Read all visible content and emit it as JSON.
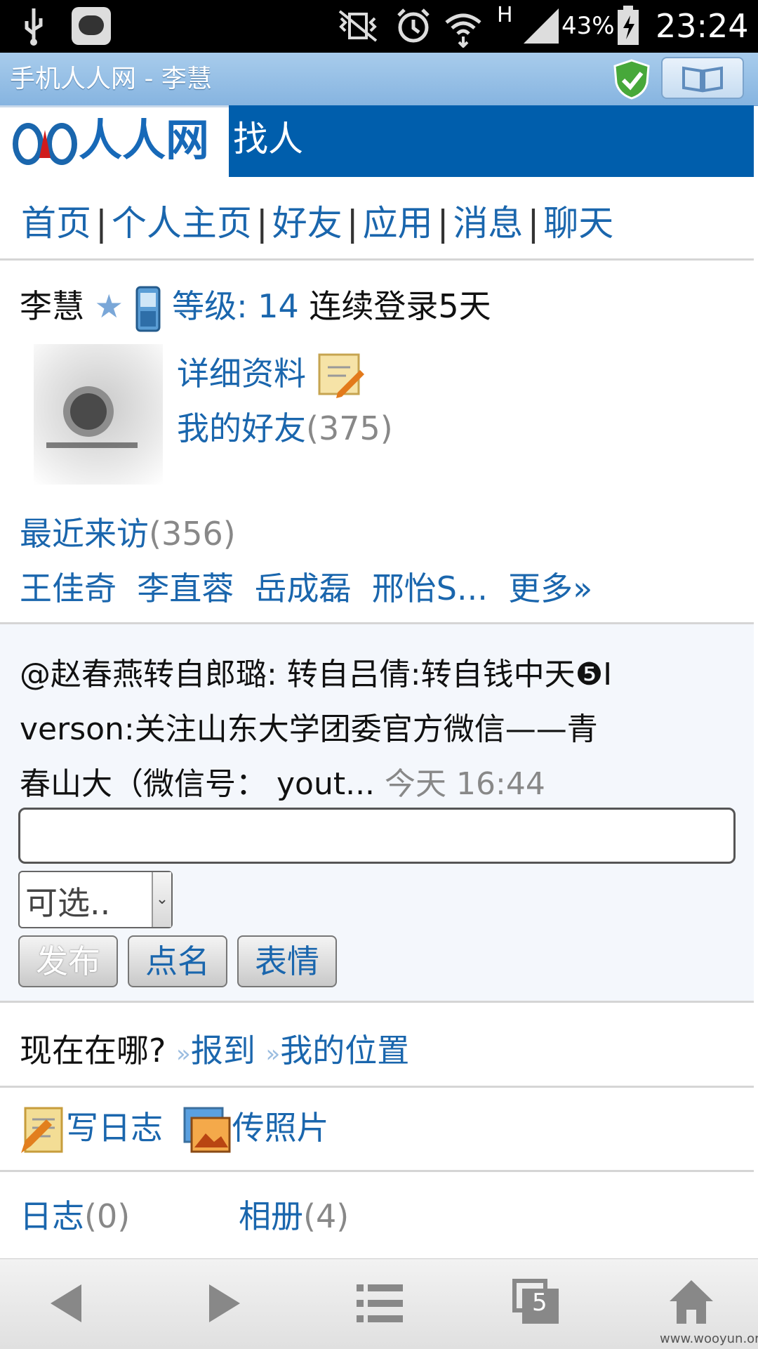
{
  "status_bar": {
    "battery": "43%",
    "network": "H",
    "time": "23:24"
  },
  "browser": {
    "title": "手机人人网 - 李慧"
  },
  "header": {
    "logo": "人人网",
    "page_title": "找人"
  },
  "nav": [
    "首页",
    "个人主页",
    "好友",
    "应用",
    "消息",
    "聊天"
  ],
  "profile": {
    "name": "李慧",
    "level": "等级: 14",
    "login_streak": "连续登录5天",
    "details_link": "详细资料",
    "friends_label": "我的好友",
    "friends_count": "(375)",
    "visitors_label": "最近来访",
    "visitors_count": "(356)",
    "recent_visitors": [
      "王佳奇",
      "李直蓉",
      "岳成磊",
      "邢怡S..."
    ],
    "more_link": "更多»"
  },
  "status_post": {
    "text_line1": "@赵春燕转自郎璐: 转自吕倩:转自钱中天❺I",
    "text_line2": "verson:关注山东大学团委官方微信——青",
    "text_line3": "春山大（微信号： yout...",
    "time": "今天 16:44",
    "input_placeholder": "",
    "select_value": "可选..",
    "buttons": [
      "发布",
      "点名",
      "表情"
    ]
  },
  "location": {
    "question": "现在在哪?",
    "checkin": "报到",
    "my_location": "我的位置"
  },
  "actions": {
    "write_blog": "写日志",
    "upload_photo": "传照片"
  },
  "stats": {
    "blog_label": "日志",
    "blog_count": "(0)",
    "album_label": "相册",
    "album_count": "(4)"
  },
  "bottom_nav": {
    "tabs_count": "5"
  },
  "watermark": "www.wooyun.org",
  "colors": {
    "link": "#1a66ad",
    "header_band": "#005eac",
    "title_bar": "#86b4e0"
  }
}
